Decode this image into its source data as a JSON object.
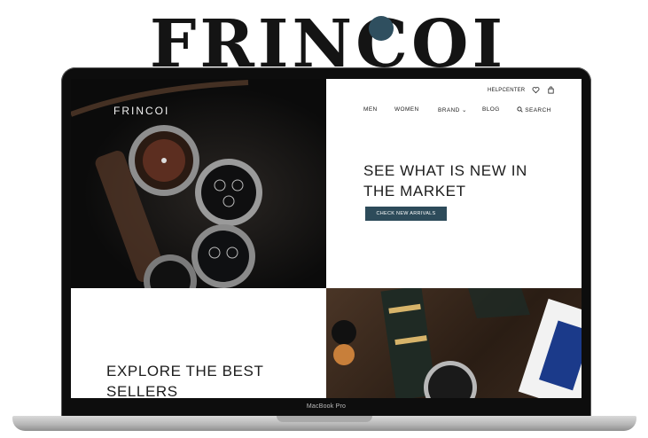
{
  "brand_wordmark": "FRINCOI",
  "laptop": {
    "model_label": "MacBook Pro"
  },
  "site": {
    "logo": "FRINCOI",
    "utility_nav": {
      "help_center": "HELPCENTER",
      "wishlist_icon": "heart-icon",
      "cart_icon": "bag-icon"
    },
    "main_nav": [
      {
        "label": "MEN"
      },
      {
        "label": "WOMEN"
      },
      {
        "label": "BRAND ⌄"
      },
      {
        "label": "BLOG"
      },
      {
        "label": "SEARCH",
        "icon": "search-icon"
      }
    ],
    "hero": {
      "heading_line1": "SEE WHAT IS NEW IN",
      "heading_line2": "THE MARKET",
      "cta_label": "CHECK NEW ARRIVALS"
    },
    "best_sellers": {
      "heading_line1": "EXPLORE THE BEST",
      "heading_line2": "SELLERS"
    }
  },
  "colors": {
    "accent": "#2d4b5a",
    "brand_dot": "#2f4f5f",
    "text": "#1c1c1c"
  }
}
